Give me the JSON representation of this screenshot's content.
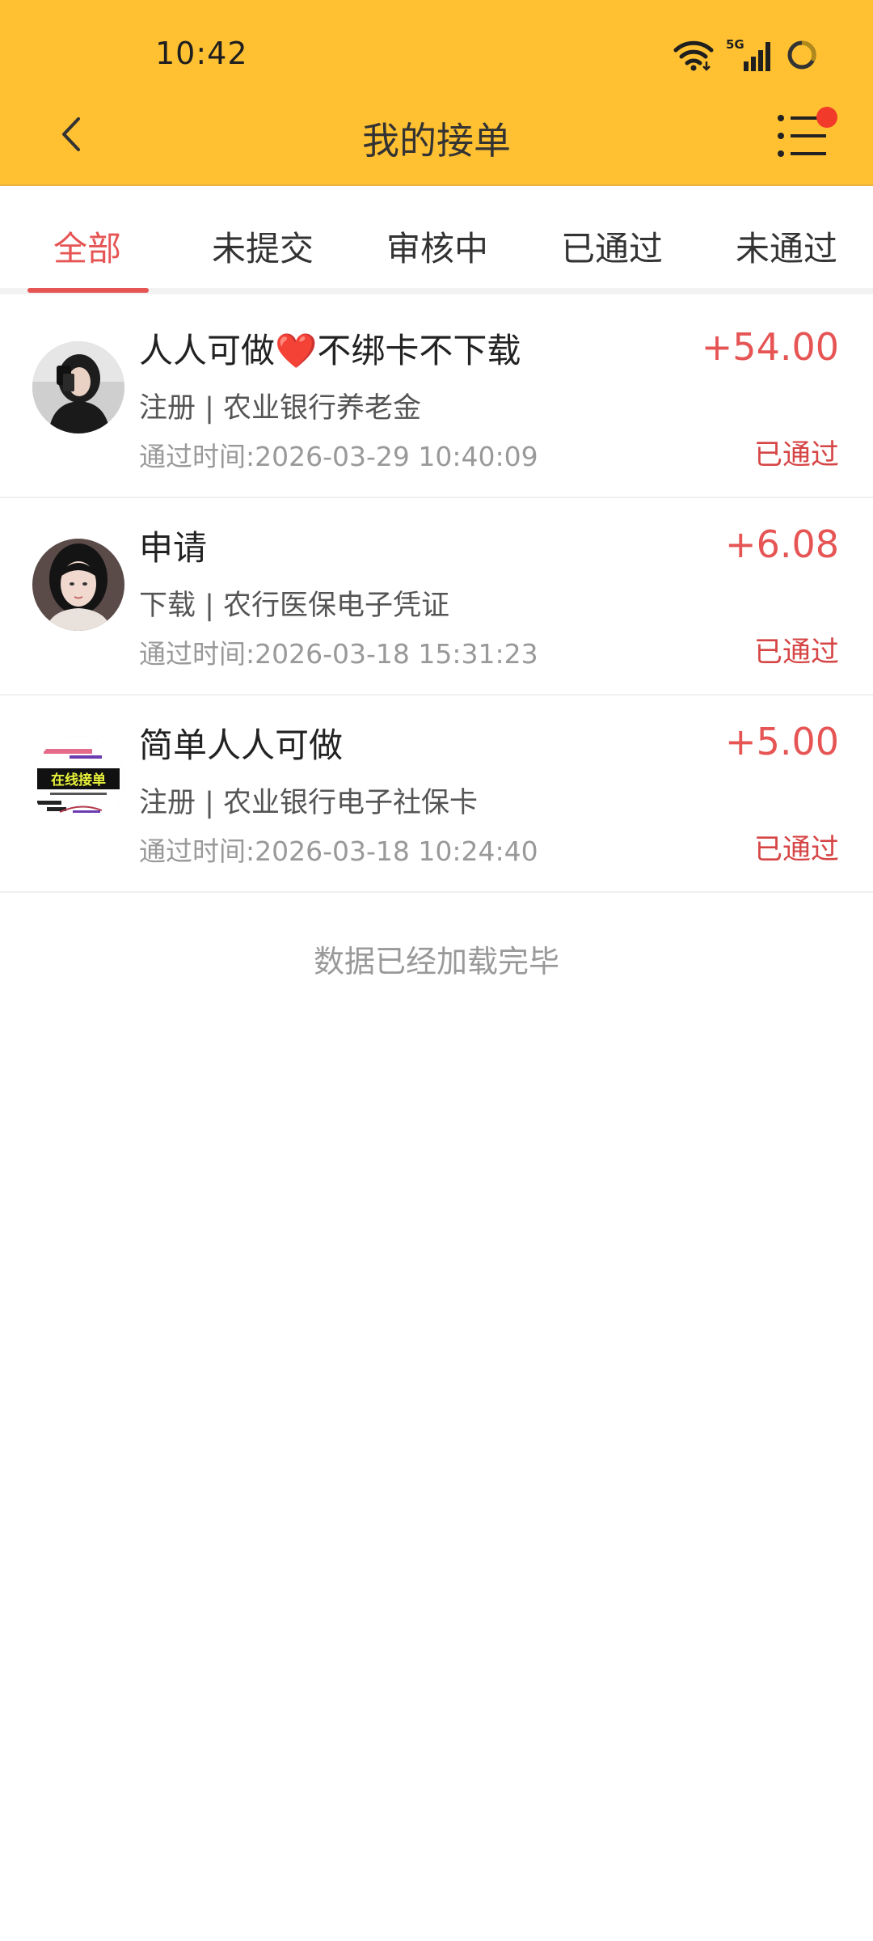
{
  "status_bar": {
    "time": "10:42",
    "network_label": "5G",
    "icons": [
      "wifi-icon",
      "cellular-signal-icon",
      "battery-icon"
    ]
  },
  "header": {
    "title": "我的接单",
    "back_icon": "back-arrow-icon",
    "menu_icon": "list-menu-icon",
    "has_notification": true
  },
  "tabs": [
    {
      "label": "全部",
      "active": true
    },
    {
      "label": "未提交",
      "active": false
    },
    {
      "label": "审核中",
      "active": false
    },
    {
      "label": "已通过",
      "active": false
    },
    {
      "label": "未通过",
      "active": false
    }
  ],
  "orders": [
    {
      "title_before": "人人可做",
      "title_emoji": "❤️",
      "title_after": "不绑卡不下载",
      "subtitle": "注册 | 农业银行养老金",
      "time": "通过时间:2026-03-29 10:40:09",
      "amount": "+54.00",
      "status": "已通过"
    },
    {
      "title_before": "申请",
      "title_emoji": "",
      "title_after": "",
      "subtitle": "下载 | 农行医保电子凭证",
      "time": "通过时间:2026-03-18 15:31:23",
      "amount": "+6.08",
      "status": "已通过"
    },
    {
      "title_before": "简单人人可做",
      "title_emoji": "",
      "title_after": "",
      "subtitle": "注册 | 农业银行电子社保卡",
      "time": "通过时间:2026-03-18 10:24:40",
      "amount": "+5.00",
      "status": "已通过"
    }
  ],
  "avatar_logo_text": "在线接单",
  "footer": {
    "load_complete": "数据已经加载完毕"
  },
  "colors": {
    "header_bg": "#FFC132",
    "accent_red": "#E65454",
    "notification_dot": "#F23A2B"
  }
}
